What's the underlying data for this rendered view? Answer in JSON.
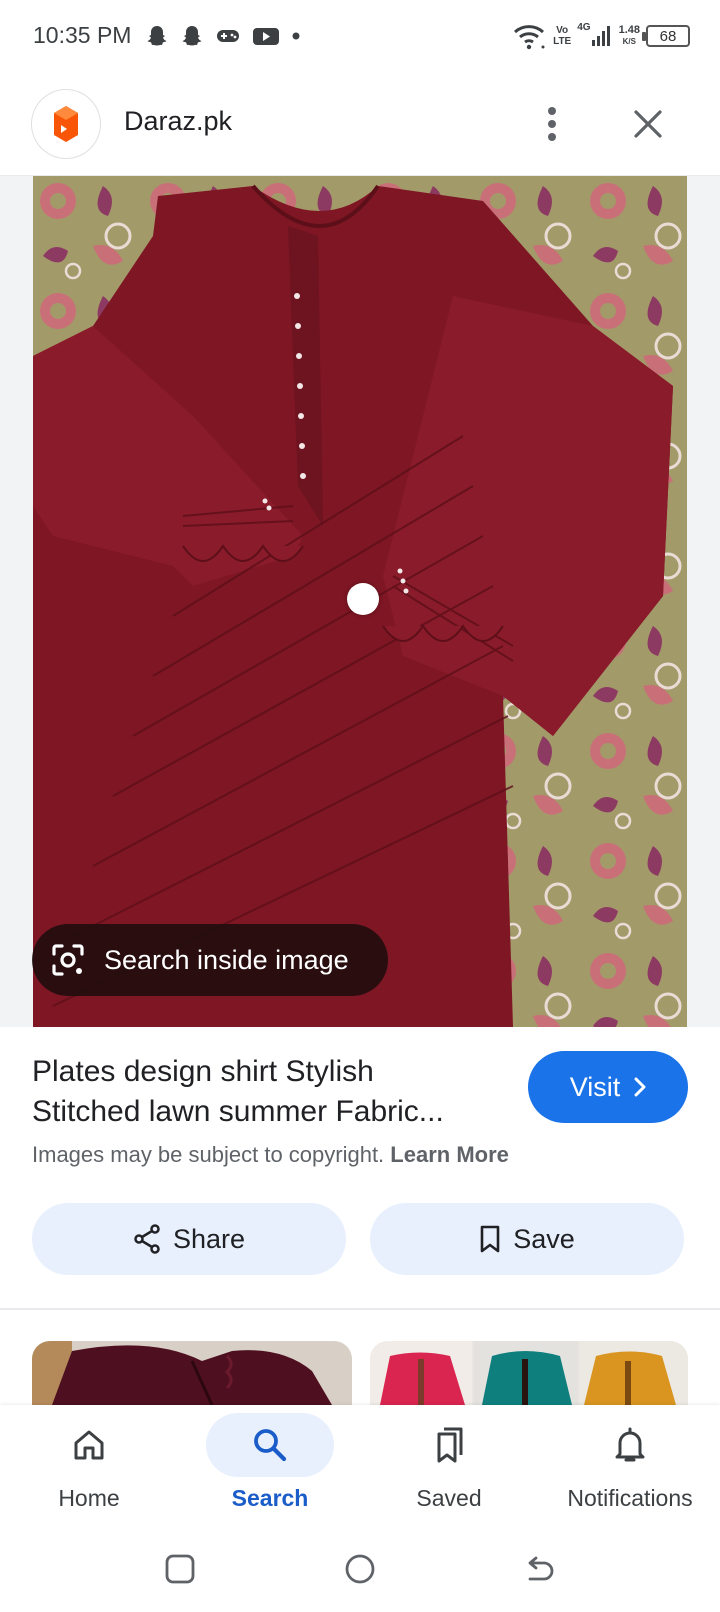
{
  "status_bar": {
    "time": "10:35 PM",
    "notification_icons": [
      "snapchat-icon",
      "snapchat-icon",
      "gamepad-icon",
      "youtube-icon",
      "dot-icon"
    ],
    "network_top": "Vo",
    "network_bottom": "LTE",
    "network_gen": "4G",
    "speed_value": "1.48",
    "speed_unit": "K/S",
    "battery": "68"
  },
  "header": {
    "site_name": "Daraz.pk",
    "logo_color": "#f85606"
  },
  "image": {
    "lens_label": "Search inside image"
  },
  "result": {
    "title_line1": "Plates design shirt Stylish",
    "title_line2": "Stitched lawn summer Fabric...",
    "visit_label": "Visit",
    "copyright_text": "Images may be subject to copyright.",
    "learn_more": "Learn More",
    "share_label": "Share",
    "save_label": "Save"
  },
  "bottom_nav": {
    "items": [
      {
        "label": "Home",
        "icon": "home-icon",
        "active": false
      },
      {
        "label": "Search",
        "icon": "search-icon",
        "active": true
      },
      {
        "label": "Saved",
        "icon": "bookmarks-icon",
        "active": false
      },
      {
        "label": "Notifications",
        "icon": "bell-icon",
        "active": false
      }
    ]
  },
  "colors": {
    "accent": "#1a73e8",
    "chip_background": "#e8f0fe",
    "garment": "#7e1624"
  }
}
